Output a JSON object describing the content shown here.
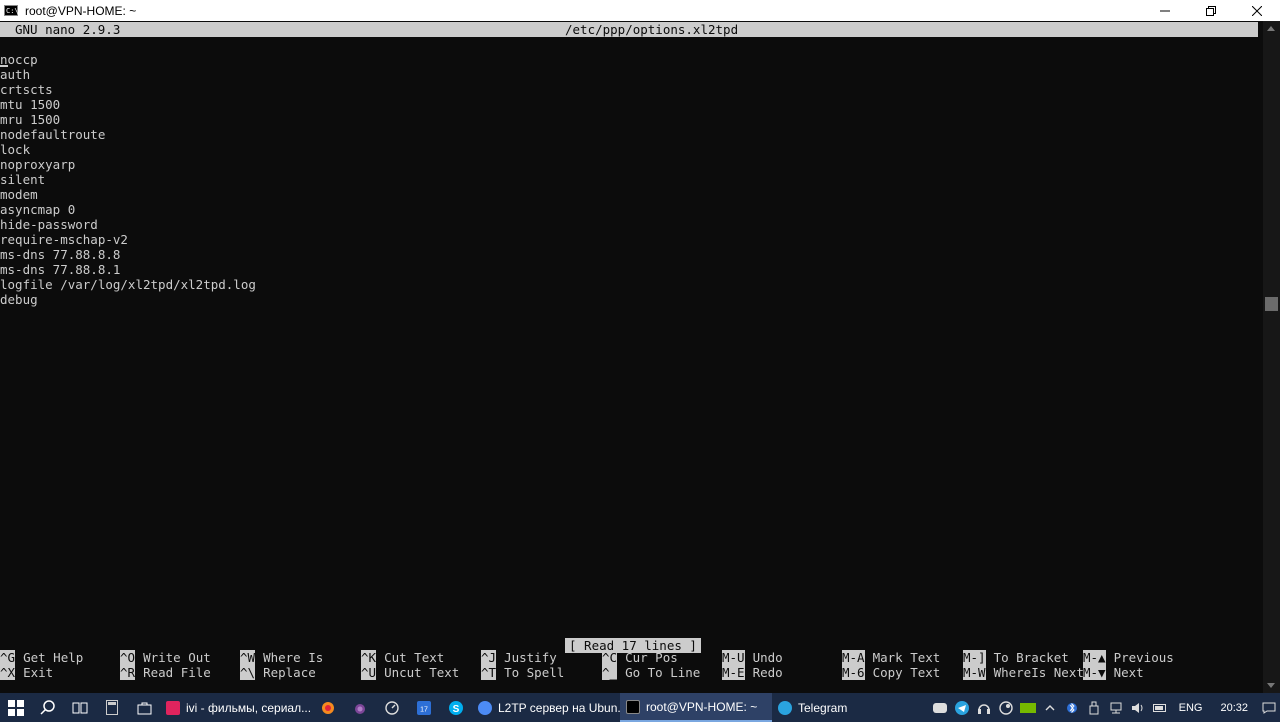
{
  "window": {
    "title": "root@VPN-HOME: ~",
    "app_icon_text": "C:\\."
  },
  "nano": {
    "version": "GNU nano 2.9.3",
    "filename": "/etc/ppp/options.xl2tpd",
    "lines": [
      "noccp",
      "auth",
      "crtscts",
      "mtu 1500",
      "mru 1500",
      "nodefaultroute",
      "lock",
      "noproxyarp",
      "silent",
      "modem",
      "asyncmap 0",
      "hide-password",
      "require-mschap-v2",
      "ms-dns 77.88.8.8",
      "ms-dns 77.88.8.1",
      "logfile /var/log/xl2tpd/xl2tpd.log",
      "debug"
    ],
    "status": "[ Read 17 lines ]",
    "shortcuts_row1": [
      {
        "key": "^G",
        "label": "Get Help"
      },
      {
        "key": "^O",
        "label": "Write Out"
      },
      {
        "key": "^W",
        "label": "Where Is"
      },
      {
        "key": "^K",
        "label": "Cut Text"
      },
      {
        "key": "^J",
        "label": "Justify"
      },
      {
        "key": "^C",
        "label": "Cur Pos"
      },
      {
        "key": "M-U",
        "label": "Undo"
      },
      {
        "key": "M-A",
        "label": "Mark Text"
      },
      {
        "key": "M-]",
        "label": "To Bracket"
      },
      {
        "key": "M-▲",
        "label": "Previous"
      }
    ],
    "shortcuts_row2": [
      {
        "key": "^X",
        "label": "Exit"
      },
      {
        "key": "^R",
        "label": "Read File"
      },
      {
        "key": "^\\",
        "label": "Replace"
      },
      {
        "key": "^U",
        "label": "Uncut Text"
      },
      {
        "key": "^T",
        "label": "To Spell"
      },
      {
        "key": "^_",
        "label": "Go To Line"
      },
      {
        "key": "M-E",
        "label": "Redo"
      },
      {
        "key": "M-6",
        "label": "Copy Text"
      },
      {
        "key": "M-W",
        "label": "WhereIs Next"
      },
      {
        "key": "M-▼",
        "label": "Next"
      }
    ]
  },
  "taskbar": {
    "apps": [
      {
        "label": "ivi - фильмы, сериал...",
        "color": "#e0245e"
      },
      {
        "label": "L2TP сервер на Ubun...",
        "color": "#4c8bf5"
      },
      {
        "label": "root@VPN-HOME: ~",
        "color": "#000000"
      },
      {
        "label": "Telegram",
        "color": "#2aa3df"
      }
    ],
    "language": "ENG",
    "time": "20:32"
  }
}
